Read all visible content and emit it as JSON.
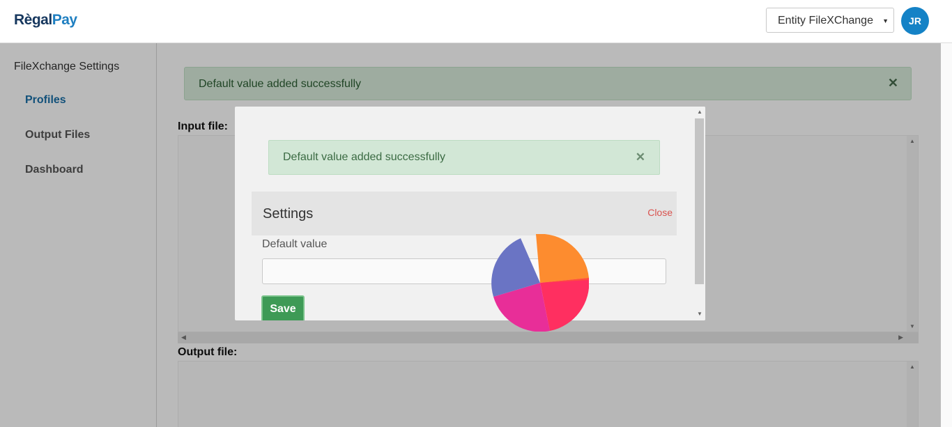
{
  "header": {
    "logo_part1": "Règal",
    "logo_part2": "Pay",
    "entity_select": "Entity FileXChange",
    "avatar_initials": "JR"
  },
  "sidebar": {
    "title": "FileXchange Settings",
    "items": [
      {
        "label": "Profiles",
        "active": true
      },
      {
        "label": "Output Files",
        "active": false
      },
      {
        "label": "Dashboard",
        "active": false
      }
    ]
  },
  "main": {
    "alert_text": "Default value added successfully",
    "input_file_label": "Input file:",
    "output_file_label": "Output file:"
  },
  "modal": {
    "alert_text": "Default value added successfully",
    "title": "Settings",
    "close_label": "Close",
    "field_label": "Default value",
    "field_value": "",
    "field_placeholder": "",
    "save_label": "Save"
  },
  "colors": {
    "brand_dark": "#16375e",
    "brand_light": "#1f7fc1",
    "avatar_bg": "#1482c6",
    "sidebar_active": "#1a6fa8",
    "success_bg": "#d9ecdc",
    "save_button": "#3e9a56",
    "close_text": "#d9534f",
    "loader_slices": [
      "#fd8c2f",
      "#ff2f60",
      "#e82e98",
      "#6a74c4"
    ]
  }
}
